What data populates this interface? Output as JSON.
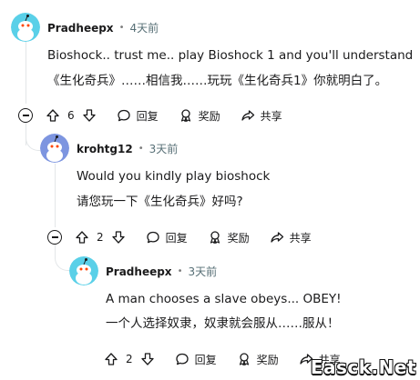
{
  "comments": [
    {
      "username": "Pradheepx",
      "time": "4天前",
      "line1": "Bioshock.. trust me.. play Bioshock 1 and you'll understand",
      "line2": "《生化奇兵》……相信我……玩玩《生化奇兵1》你就明白了。",
      "votes": "6",
      "reply": "回复",
      "award": "奖励",
      "share": "共享"
    },
    {
      "username": "krohtg12",
      "time": "3天前",
      "line1": "Would you kindly play bioshock",
      "line2": "请您玩一下《生化奇兵》好吗?",
      "votes": "2",
      "reply": "回复",
      "award": "奖励",
      "share": "共享"
    },
    {
      "username": "Pradheepx",
      "time": "3天前",
      "line1": "A man chooses a slave obeys... OBEY!",
      "line2": "一个人选择奴隶，奴隶就会服从……服从！",
      "votes": "2",
      "reply": "回复",
      "award": "奖励",
      "share": "共享"
    }
  ],
  "watermark": "Easck.Net",
  "colors": {
    "avatar1": "#5ad0e8",
    "avatar2": "#7d95e0",
    "avatar3": "#5ad0e8",
    "meta": "#576f76",
    "line": "#e3e6e8"
  }
}
